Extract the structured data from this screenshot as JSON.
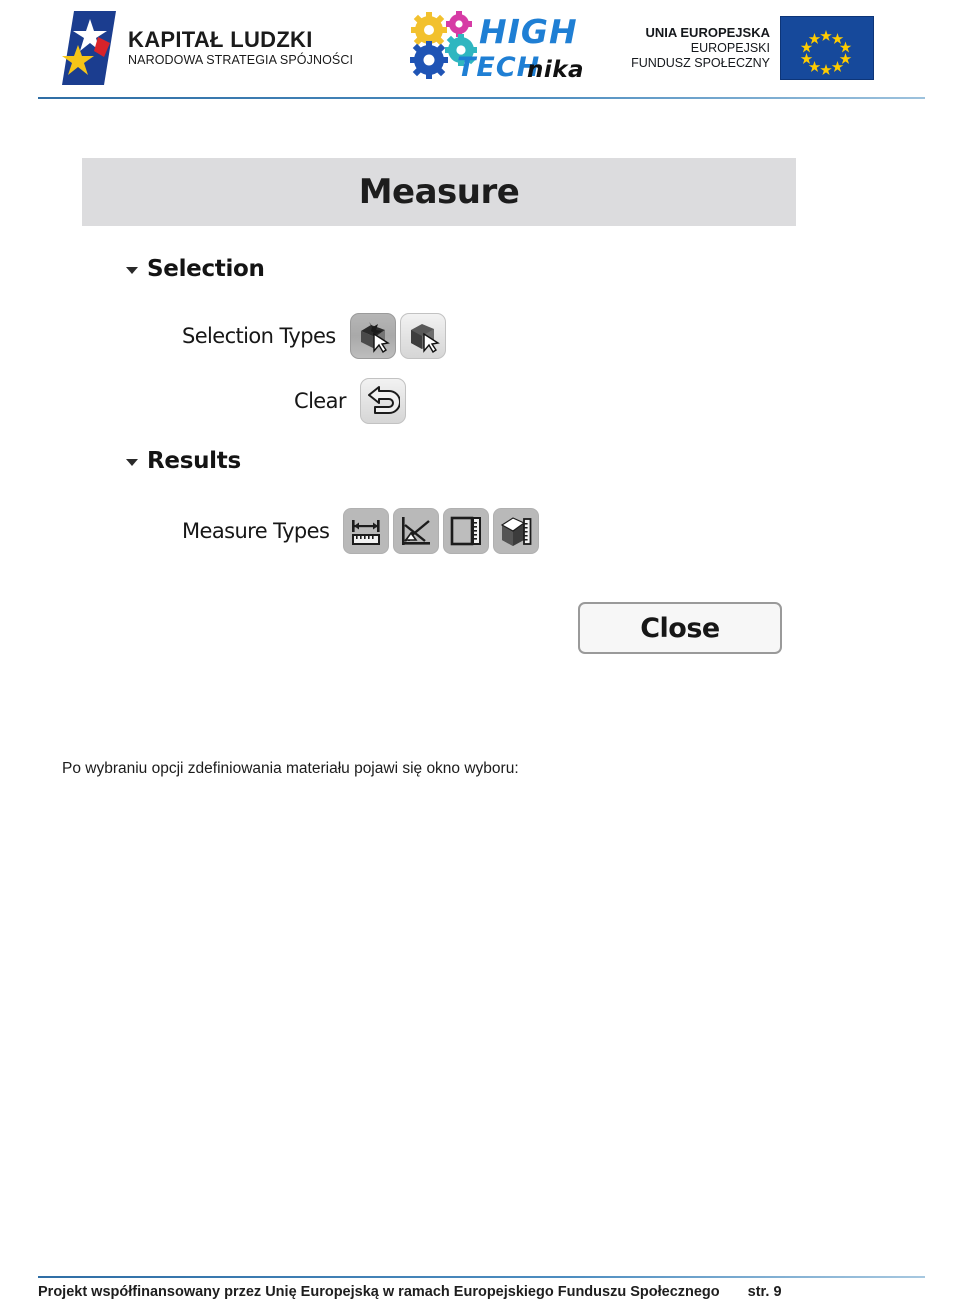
{
  "header": {
    "kapital_ludzki": {
      "title": "KAPITAŁ LUDZKI",
      "subtitle": "NARODOWA STRATEGIA SPÓJNOŚCI",
      "icon": "star-flag-icon"
    },
    "high_technika": {
      "word_high": "HIGH",
      "word_tech": "TECH",
      "word_nika": "nika",
      "icon": "gears-icon"
    },
    "european_union": {
      "line1": "UNIA EUROPEJSKA",
      "line2": "EUROPEJSKI",
      "line3": "FUNDUSZ SPOŁECZNY",
      "icon": "eu-flag-icon"
    }
  },
  "screenshot": {
    "window_title": "Measure",
    "groups": [
      {
        "label": "Selection",
        "expander_icon": "triangle-down-icon",
        "rows": [
          {
            "label": "Selection Types",
            "buttons": [
              {
                "icon": "select-face-cube-icon",
                "state": "pressed"
              },
              {
                "icon": "select-body-cube-icon",
                "state": "normal"
              }
            ]
          },
          {
            "label": "Clear",
            "buttons": [
              {
                "icon": "undo-arrow-icon",
                "state": "normal"
              }
            ]
          }
        ]
      },
      {
        "label": "Results",
        "expander_icon": "triangle-down-icon",
        "rows": [
          {
            "label": "Measure Types",
            "buttons": [
              {
                "icon": "distance-ruler-icon",
                "state": "flat"
              },
              {
                "icon": "angle-measure-icon",
                "state": "flat"
              },
              {
                "icon": "area-measure-icon",
                "state": "flat"
              },
              {
                "icon": "volume-measure-icon",
                "state": "flat"
              }
            ]
          }
        ]
      }
    ],
    "close_button": "Close"
  },
  "content": {
    "paragraph": "Po wybraniu opcji zdefiniowania materiału pojawi się okno wyboru:"
  },
  "footer": {
    "text": "Projekt współfinansowany przez Unię Europejską w ramach Europejskiego Funduszu Społecznego",
    "page": "str. 9"
  },
  "colors": {
    "accent_blue": "#2f6ea5",
    "panel_gray": "#dcdcde",
    "eu_blue": "#16499b",
    "eu_star_yellow": "#ffcc00"
  }
}
